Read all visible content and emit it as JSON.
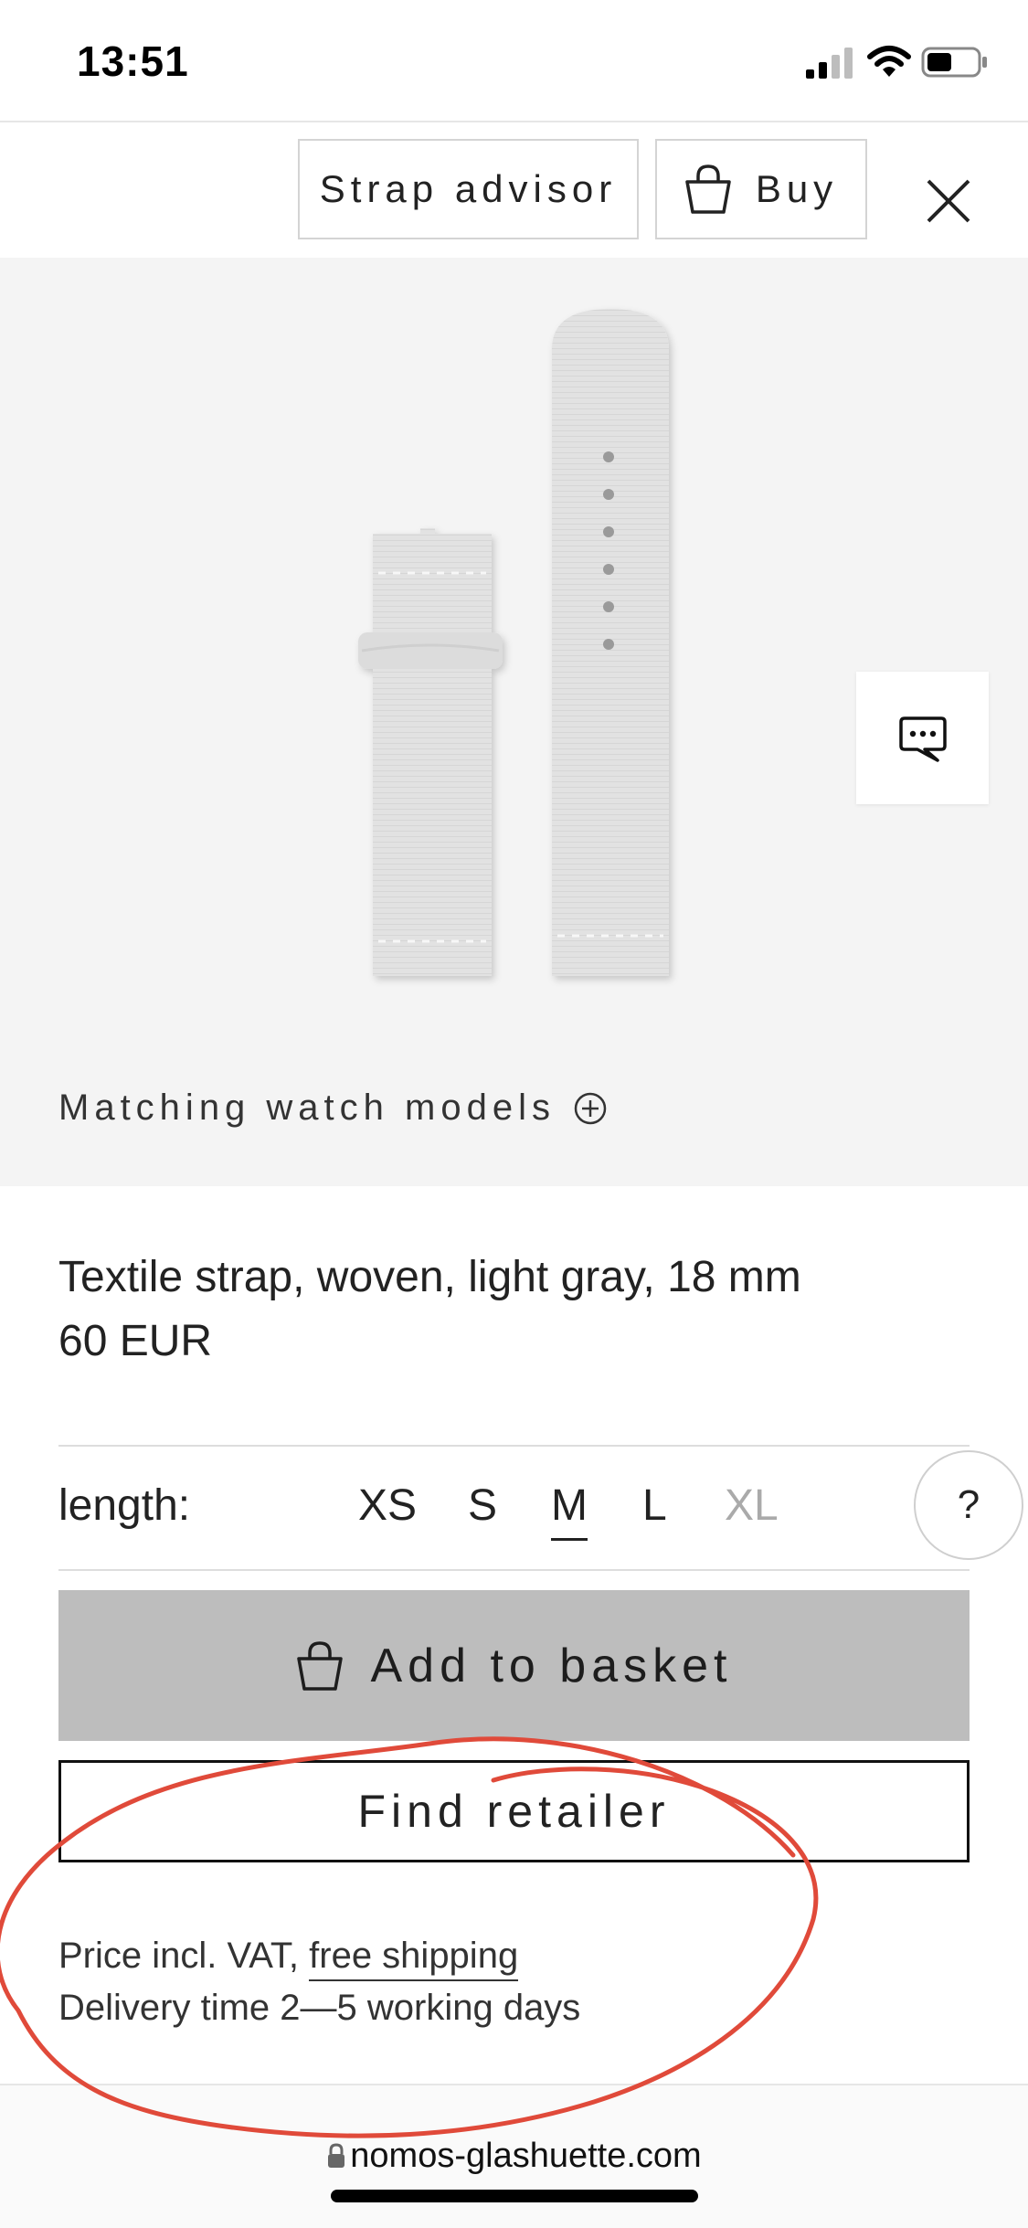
{
  "status_bar": {
    "time": "13:51"
  },
  "header": {
    "strap_advisor_label": "Strap advisor",
    "buy_label": "Buy"
  },
  "product": {
    "matching_models_label": "Matching watch models",
    "title": "Textile strap, woven, light gray, 18 mm",
    "price": "60 EUR"
  },
  "length_selector": {
    "label": "length:",
    "sizes": [
      {
        "label": "XS",
        "state": "available"
      },
      {
        "label": "S",
        "state": "available"
      },
      {
        "label": "M",
        "state": "selected"
      },
      {
        "label": "L",
        "state": "available"
      },
      {
        "label": "XL",
        "state": "unavailable"
      }
    ],
    "help_label": "?"
  },
  "actions": {
    "add_to_basket_label": "Add to basket",
    "find_retailer_label": "Find retailer"
  },
  "notes": {
    "price_prefix": "Price incl. VAT, ",
    "free_shipping_link": "free shipping",
    "delivery": "Delivery time 2—5 working days"
  },
  "browser": {
    "url": "nomos-glashuette.com"
  },
  "colors": {
    "add_to_basket_bg": "#bdbdbd",
    "image_bg": "#f4f4f4",
    "annotation_red": "#e04a3a"
  },
  "icons": [
    "basket-icon",
    "close-icon",
    "chat-icon",
    "plus-circle-icon",
    "lock-icon",
    "signal-icon",
    "wifi-icon",
    "battery-icon"
  ]
}
